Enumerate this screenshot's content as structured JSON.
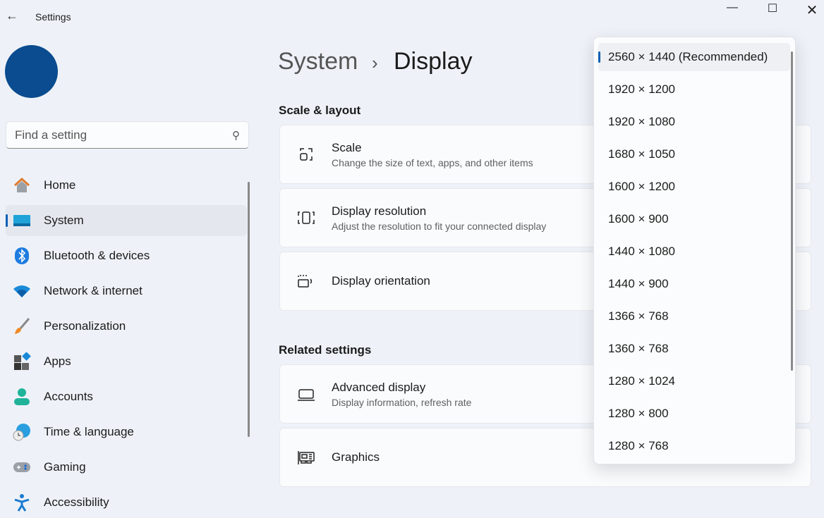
{
  "window": {
    "title": "Settings"
  },
  "search": {
    "placeholder": "Find a setting"
  },
  "nav": [
    {
      "label": "Home",
      "icon": "home-icon"
    },
    {
      "label": "System",
      "icon": "system-icon",
      "selected": true
    },
    {
      "label": "Bluetooth & devices",
      "icon": "bluetooth-icon"
    },
    {
      "label": "Network & internet",
      "icon": "wifi-icon"
    },
    {
      "label": "Personalization",
      "icon": "brush-icon"
    },
    {
      "label": "Apps",
      "icon": "apps-icon"
    },
    {
      "label": "Accounts",
      "icon": "person-icon"
    },
    {
      "label": "Time & language",
      "icon": "globe-clock-icon"
    },
    {
      "label": "Gaming",
      "icon": "gamepad-icon"
    },
    {
      "label": "Accessibility",
      "icon": "accessibility-icon"
    }
  ],
  "breadcrumb": {
    "parent": "System",
    "sep": "›",
    "current": "Display"
  },
  "sections": {
    "scale_layout": "Scale & layout",
    "related": "Related settings"
  },
  "cards": {
    "scale": {
      "title": "Scale",
      "subtitle": "Change the size of text, apps, and other items"
    },
    "resolution": {
      "title": "Display resolution",
      "subtitle": "Adjust the resolution to fit your connected display"
    },
    "orientation": {
      "title": "Display orientation"
    },
    "advanced": {
      "title": "Advanced display",
      "subtitle": "Display information, refresh rate"
    },
    "graphics": {
      "title": "Graphics"
    }
  },
  "resolution_options": [
    "2560 × 1440 (Recommended)",
    "1920 × 1200",
    "1920 × 1080",
    "1680 × 1050",
    "1600 × 1200",
    "1600 × 900",
    "1440 × 1080",
    "1440 × 900",
    "1366 × 768",
    "1360 × 768",
    "1280 × 1024",
    "1280 × 800",
    "1280 × 768"
  ],
  "selected_resolution": "2560 × 1440 (Recommended)",
  "colors": {
    "accent": "#0a5fb4",
    "avatar": "#0b4b8f"
  }
}
